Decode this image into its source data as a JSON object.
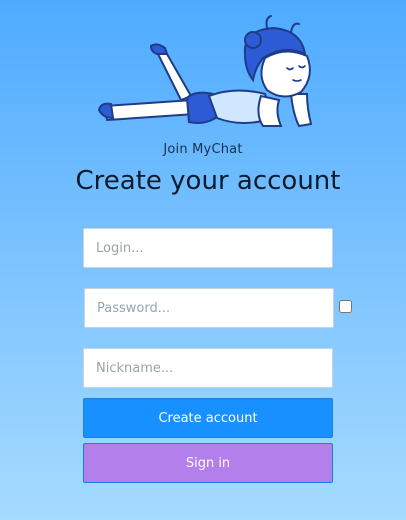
{
  "app": {
    "tagline": "Join MyChat",
    "heading": "Create your account"
  },
  "form": {
    "login": {
      "placeholder": "Login...",
      "value": ""
    },
    "password": {
      "placeholder": "Password...",
      "value": ""
    },
    "nickname": {
      "placeholder": "Nickname...",
      "value": ""
    },
    "show_password_checked": false
  },
  "buttons": {
    "create_account": "Create account",
    "sign_in": "Sign in"
  },
  "colors": {
    "background_top": "#4fabff",
    "background_bottom": "#a6dbff",
    "primary": "#1890ff",
    "secondary": "#b37feb"
  },
  "illustration": {
    "icon": "girl-lying-reading-illustration"
  }
}
